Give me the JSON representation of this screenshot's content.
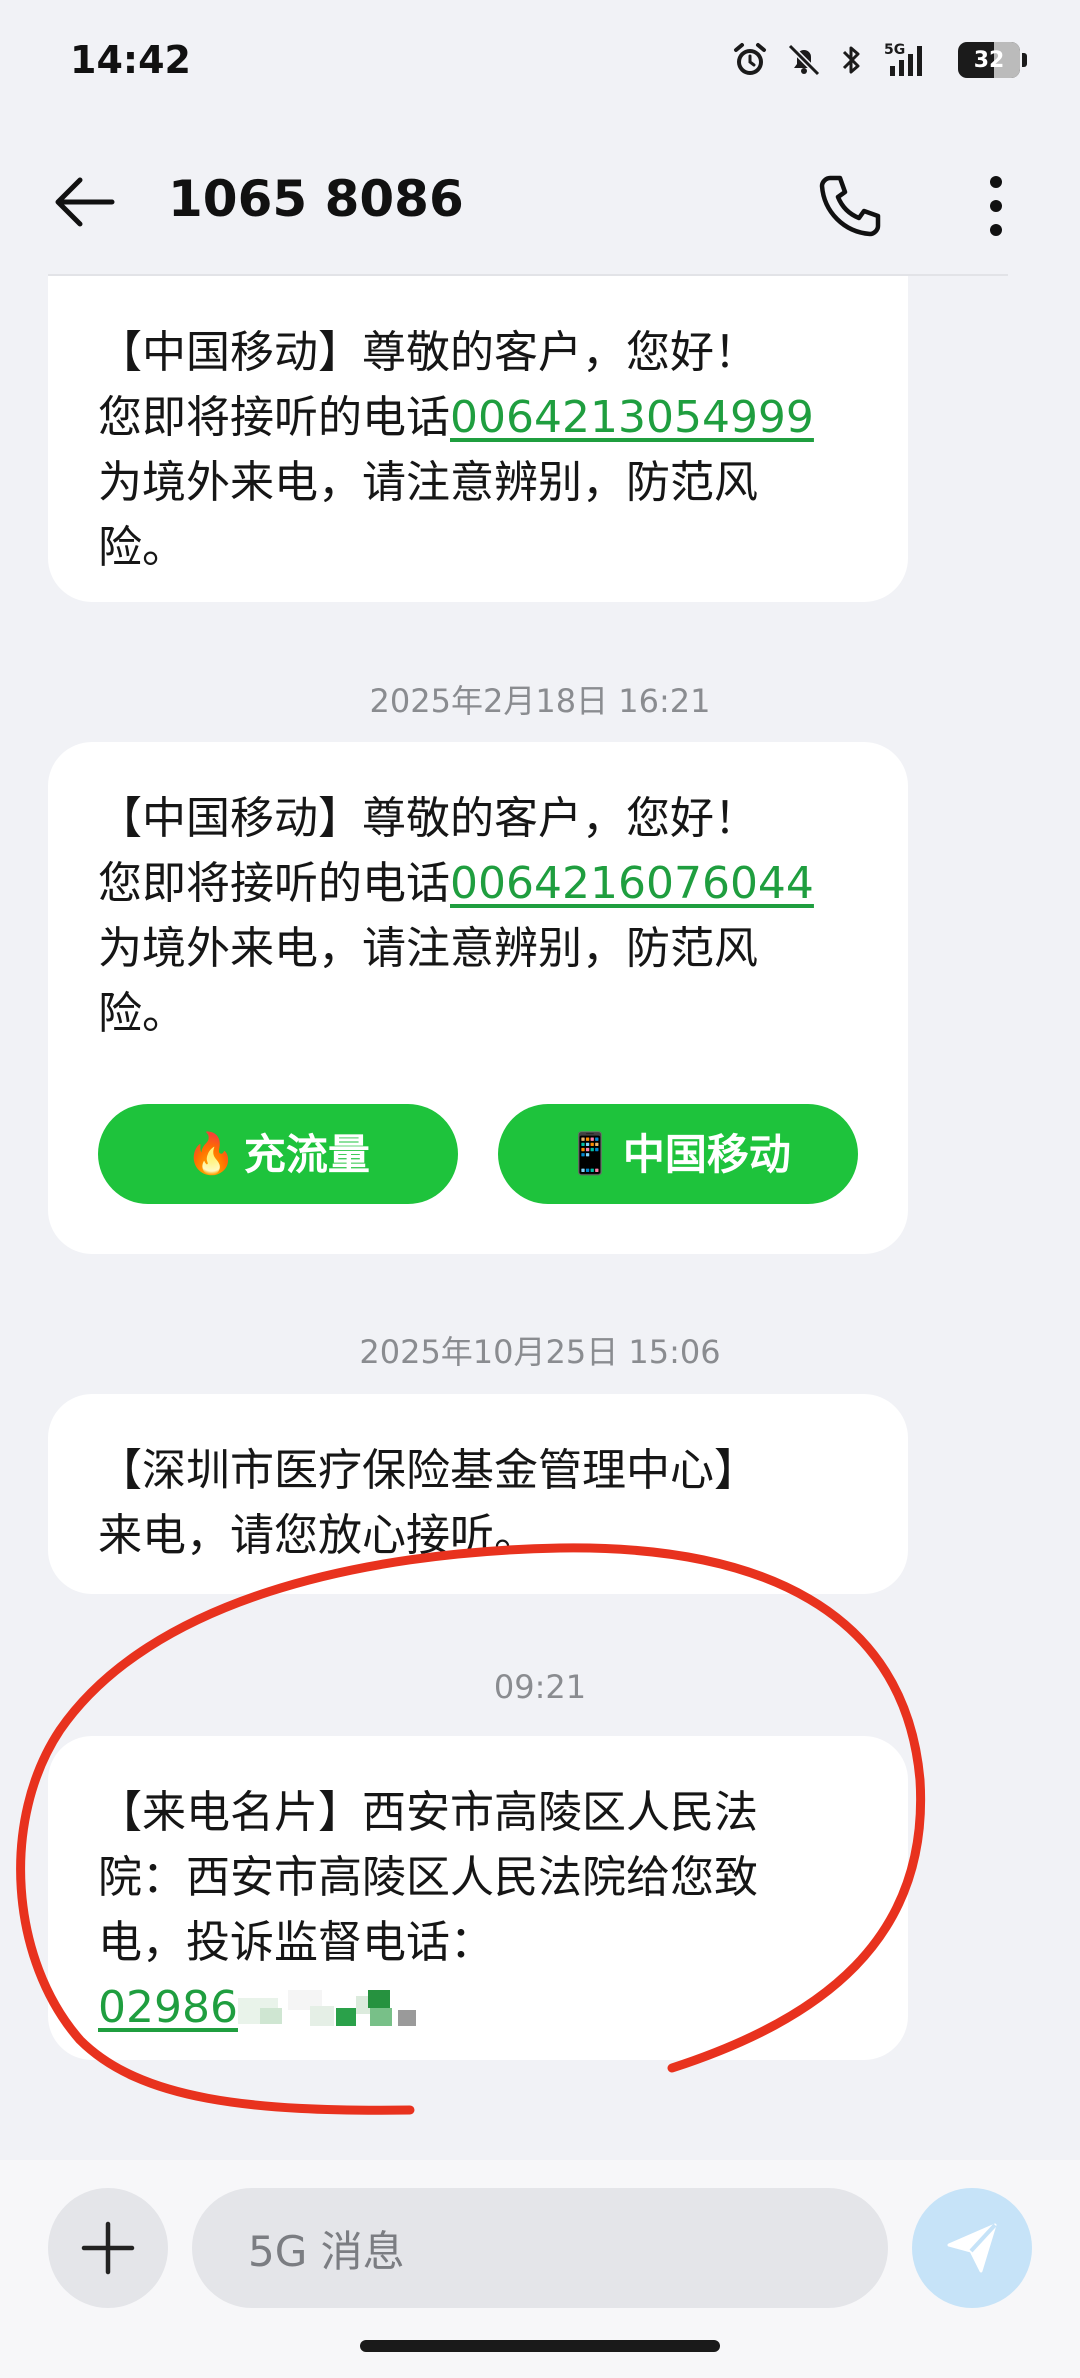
{
  "status_bar": {
    "time": "14:42",
    "network": "5G",
    "battery": "32",
    "icons": [
      "alarm-icon",
      "mute-icon",
      "bluetooth-icon",
      "signal-icon"
    ]
  },
  "header": {
    "title": "1065 8086",
    "icons": [
      "back-arrow-icon",
      "phone-icon",
      "more-vertical-icon"
    ]
  },
  "messages": [
    {
      "line1": "【中国移动】尊敬的客户，您好！",
      "line2_prefix": "您即将接听的电话",
      "phone": "0064213054999",
      "line3": "为境外来电，请注意辨别，防范风",
      "line4": "险。"
    },
    {
      "timestamp": "2025年2月18日 16:21",
      "line1": "【中国移动】尊敬的客户，您好！",
      "line2_prefix": "您即将接听的电话",
      "phone": "0064216076044",
      "line3": "为境外来电，请注意辨别，防范风",
      "line4": "险。",
      "actions": [
        {
          "icon": "🔥",
          "label": "充流量"
        },
        {
          "icon": "📱",
          "label": "中国移动"
        }
      ]
    },
    {
      "timestamp": "2025年10月25日 15:06",
      "line1": "【深圳市医疗保险基金管理中心】",
      "line2": "来电，请您放心接听。"
    },
    {
      "timestamp": "09:21",
      "line1": "【来电名片】西安市高陵区人民法",
      "line2": "院：西安市高陵区人民法院给您致",
      "line3": "电，投诉监督电话：",
      "phone_partial": "02986"
    }
  ],
  "composer": {
    "placeholder": "5G 消息"
  },
  "colors": {
    "link": "#1f9e3f",
    "action_button": "#1ec33c",
    "annotation": "#e8321e",
    "send_button": "#c6e3f8"
  }
}
